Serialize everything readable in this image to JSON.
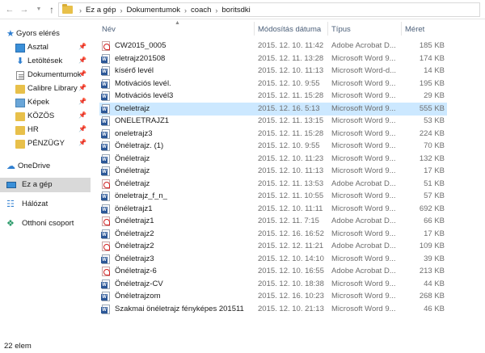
{
  "address": {
    "crumbs": [
      "Ez a gép",
      "Dokumentumok",
      "coach",
      "boritsdki"
    ]
  },
  "nav": {
    "quick_access": "Gyors elérés",
    "items": [
      {
        "label": "Asztal",
        "icon": "desktop-icon",
        "pinned": true
      },
      {
        "label": "Letöltések",
        "icon": "download-icon",
        "pinned": true
      },
      {
        "label": "Dokumentumok",
        "icon": "documents-icon",
        "pinned": true
      },
      {
        "label": "Calibre Library",
        "icon": "folder-icon",
        "pinned": true
      },
      {
        "label": "Képek",
        "icon": "pictures-icon",
        "pinned": true
      },
      {
        "label": "KÖZÖS",
        "icon": "folder-icon",
        "pinned": true
      },
      {
        "label": "HR",
        "icon": "folder-icon",
        "pinned": true
      },
      {
        "label": "PÉNZÜGY",
        "icon": "folder-icon",
        "pinned": true
      }
    ],
    "onedrive": "OneDrive",
    "this_pc": "Ez a gép",
    "network": "Hálózat",
    "homegroup": "Otthoni csoport"
  },
  "columns": {
    "name": "Név",
    "date": "Módosítás dátuma",
    "type": "Típus",
    "size": "Méret"
  },
  "files": [
    {
      "name": "CW2015_0005",
      "date": "2015. 12. 10. 11:42",
      "type": "Adobe Acrobat D...",
      "size": "185 KB",
      "kind": "pdf"
    },
    {
      "name": "eletrajz201508",
      "date": "2015. 12. 11. 13:28",
      "type": "Microsoft Word 9...",
      "size": "174 KB",
      "kind": "word"
    },
    {
      "name": "kísérő levél",
      "date": "2015. 12. 10. 11:13",
      "type": "Microsoft Word-d...",
      "size": "14 KB",
      "kind": "word"
    },
    {
      "name": "Motivációs levél.",
      "date": "2015. 12. 10. 9:55",
      "type": "Microsoft Word 9...",
      "size": "195 KB",
      "kind": "word"
    },
    {
      "name": "Motivációs levél3",
      "date": "2015. 12. 11. 15:28",
      "type": "Microsoft Word 9...",
      "size": "29 KB",
      "kind": "word"
    },
    {
      "name": "Oneletrajz",
      "date": "2015. 12. 16. 5:13",
      "type": "Microsoft Word 9...",
      "size": "555 KB",
      "kind": "word"
    },
    {
      "name": "ONELETRAJZ1",
      "date": "2015. 12. 11. 13:15",
      "type": "Microsoft Word 9...",
      "size": "53 KB",
      "kind": "word"
    },
    {
      "name": "oneletrajz3",
      "date": "2015. 12. 11. 15:28",
      "type": "Microsoft Word 9...",
      "size": "224 KB",
      "kind": "word"
    },
    {
      "name": "Önéletrajz. (1)",
      "date": "2015. 12. 10. 9:55",
      "type": "Microsoft Word 9...",
      "size": "70 KB",
      "kind": "word"
    },
    {
      "name": "Önéletrajz",
      "date": "2015. 12. 10. 11:23",
      "type": "Microsoft Word 9...",
      "size": "132 KB",
      "kind": "word"
    },
    {
      "name": "Önéletrajz",
      "date": "2015. 12. 10. 11:13",
      "type": "Microsoft Word 9...",
      "size": "17 KB",
      "kind": "word"
    },
    {
      "name": "Önéletrajz",
      "date": "2015. 12. 11. 13:53",
      "type": "Adobe Acrobat D...",
      "size": "51 KB",
      "kind": "pdf"
    },
    {
      "name": "öneletrajz_f_n_",
      "date": "2015. 12. 11. 10:55",
      "type": "Microsoft Word 9...",
      "size": "57 KB",
      "kind": "word"
    },
    {
      "name": "önéletrajz1",
      "date": "2015. 12. 10. 11:11",
      "type": "Microsoft Word 9...",
      "size": "692 KB",
      "kind": "word"
    },
    {
      "name": "Önéletrajz1",
      "date": "2015. 12. 11. 7:15",
      "type": "Adobe Acrobat D...",
      "size": "66 KB",
      "kind": "pdf"
    },
    {
      "name": "Önéletrajz2",
      "date": "2015. 12. 16. 16:52",
      "type": "Microsoft Word 9...",
      "size": "17 KB",
      "kind": "word"
    },
    {
      "name": "Önéletrajz2",
      "date": "2015. 12. 12. 11:21",
      "type": "Adobe Acrobat D...",
      "size": "109 KB",
      "kind": "pdf"
    },
    {
      "name": "Önéletrajz3",
      "date": "2015. 12. 10. 14:10",
      "type": "Microsoft Word 9...",
      "size": "39 KB",
      "kind": "word"
    },
    {
      "name": "Önéletrajz-6",
      "date": "2015. 12. 10. 16:55",
      "type": "Adobe Acrobat D...",
      "size": "213 KB",
      "kind": "pdf"
    },
    {
      "name": "Önéletrajz-CV",
      "date": "2015. 12. 10. 18:38",
      "type": "Microsoft Word 9...",
      "size": "44 KB",
      "kind": "word"
    },
    {
      "name": "Önéletrajzom",
      "date": "2015. 12. 16. 10:23",
      "type": "Microsoft Word 9...",
      "size": "268 KB",
      "kind": "word"
    },
    {
      "name": "Szakmai önéletrajz fényképes 201511",
      "date": "2015. 12. 10. 21:13",
      "type": "Microsoft Word 9...",
      "size": "46 KB",
      "kind": "word"
    }
  ],
  "selected_index": 5,
  "status": {
    "item_count": "22 elem"
  }
}
